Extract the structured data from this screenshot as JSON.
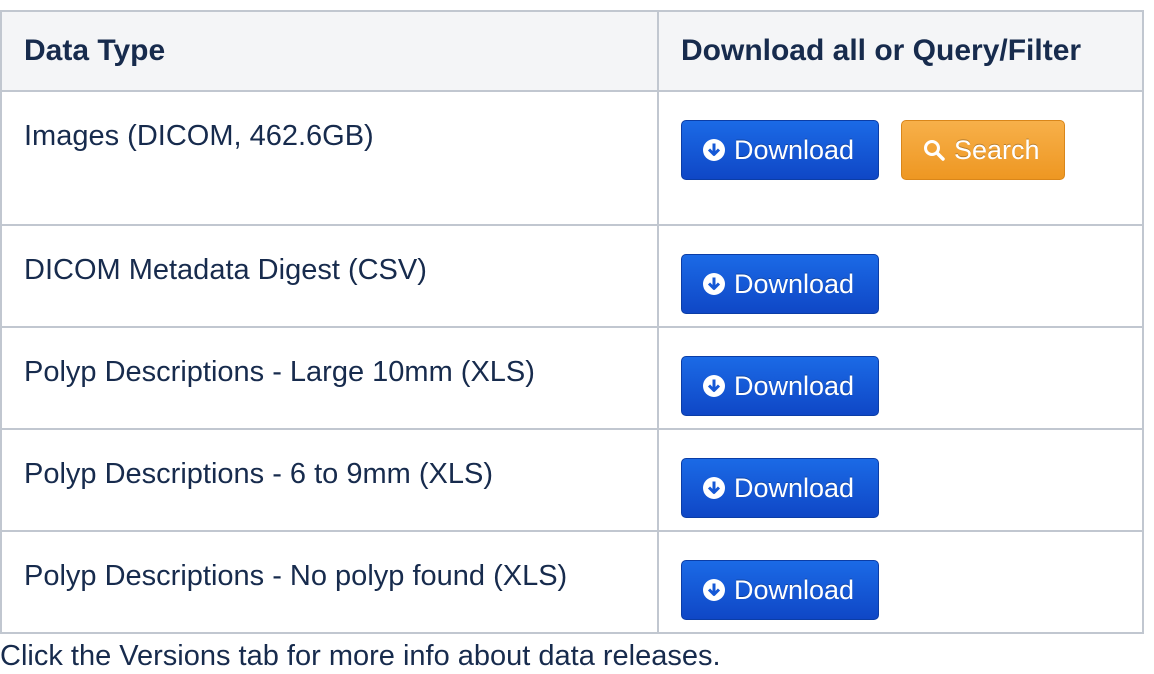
{
  "table": {
    "headers": {
      "data_type": "Data Type",
      "actions": "Download all or Query/Filter"
    },
    "rows": [
      {
        "label": "Images (DICOM, 462.6GB)",
        "download_label": "Download",
        "search_label": "Search"
      },
      {
        "label": "DICOM Metadata Digest (CSV)",
        "download_label": "Download"
      },
      {
        "label": "Polyp Descriptions - Large 10mm (XLS)",
        "download_label": "Download"
      },
      {
        "label": "Polyp Descriptions - 6 to 9mm (XLS)",
        "download_label": "Download"
      },
      {
        "label": "Polyp Descriptions - No polyp found (XLS)",
        "download_label": "Download"
      }
    ]
  },
  "footer": {
    "note": "Click the Versions tab for more info about data releases."
  },
  "icons": {
    "download": "download-circle-icon",
    "search": "magnifier-icon"
  },
  "colors": {
    "download_button": "#1558d6",
    "search_button": "#f3a536",
    "header_background": "#f4f5f7",
    "border": "#c1c7d0",
    "text": "#172b4d"
  }
}
